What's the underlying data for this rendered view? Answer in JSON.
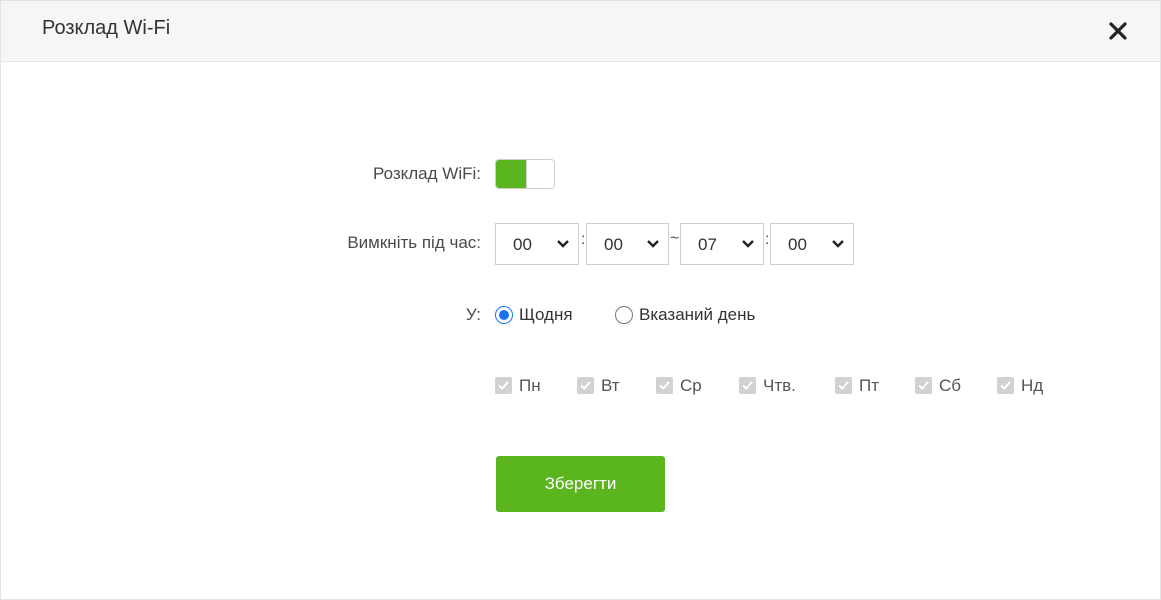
{
  "dialog": {
    "title": "Розклад Wi-Fi",
    "close_icon": "close-icon"
  },
  "form": {
    "schedule_label": "Розклад WiFi:",
    "schedule_enabled": true,
    "time_label": "Вимкніть під час:",
    "start_hour": "00",
    "start_minute": "00",
    "end_hour": "07",
    "end_minute": "00",
    "colon": ":",
    "range_separator": "~",
    "repeat_label": "У:",
    "repeat_options": [
      {
        "label": "Щодня",
        "selected": true
      },
      {
        "label": "Вказаний день",
        "selected": false
      }
    ],
    "days": [
      "Пн",
      "Вт",
      "Ср",
      "Чтв.",
      "Пт",
      "Сб",
      "Нд"
    ],
    "days_checked": true,
    "days_disabled": true,
    "save_label": "Зберегти"
  },
  "colors": {
    "accent_green": "#5ab51e",
    "radio_blue": "#1a73e8",
    "disabled_check": "#d2d2d2"
  }
}
